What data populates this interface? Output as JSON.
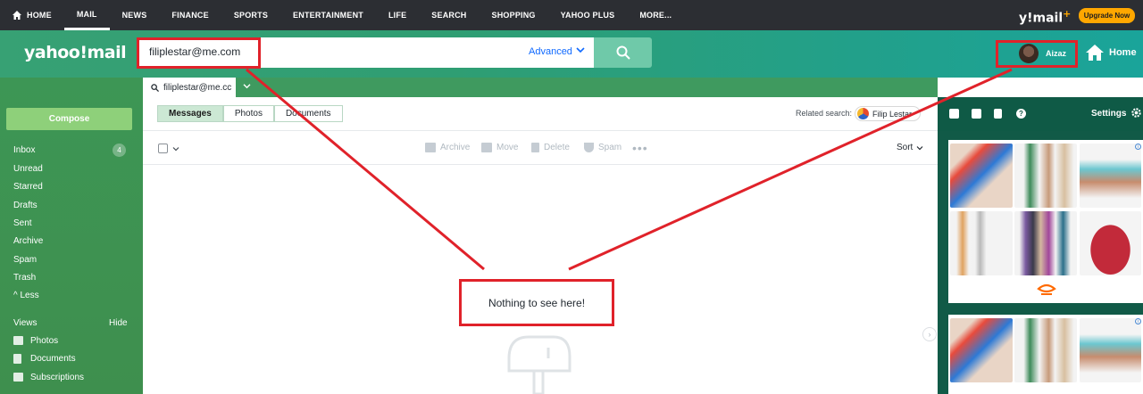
{
  "topnav": {
    "items": [
      "HOME",
      "MAIL",
      "NEWS",
      "FINANCE",
      "SPORTS",
      "ENTERTAINMENT",
      "LIFE",
      "SEARCH",
      "SHOPPING",
      "YAHOO PLUS",
      "MORE..."
    ],
    "active": "MAIL",
    "brand": "y!mail",
    "brand_plus": "+",
    "upgrade": "Upgrade Now"
  },
  "header": {
    "logo": "yahoo!mail",
    "search_value": "filiplestar@me.com",
    "advanced": "Advanced",
    "user_name": "Aizaz",
    "home": "Home"
  },
  "sidebar": {
    "compose": "Compose",
    "items": [
      "Inbox",
      "Unread",
      "Starred",
      "Drafts",
      "Sent",
      "Archive",
      "Spam",
      "Trash",
      "^ Less"
    ],
    "inbox_count": "4",
    "views_label": "Views",
    "hide": "Hide",
    "views": [
      "Photos",
      "Documents",
      "Subscriptions"
    ]
  },
  "content": {
    "tab_label": "filiplestar@me.cc",
    "filters": [
      "Messages",
      "Photos",
      "Documents"
    ],
    "related_label": "Related search:",
    "related_name": "Filip Lestar",
    "actions": [
      "Archive",
      "Move",
      "Delete",
      "Spam"
    ],
    "sort": "Sort",
    "empty": "Nothing to see here!"
  },
  "rightrail": {
    "settings": "Settings"
  },
  "colors": {
    "annotation": "#e0222a",
    "brand_green": "#37a174",
    "rail": "#115a47",
    "upgrade": "#ffa700"
  }
}
